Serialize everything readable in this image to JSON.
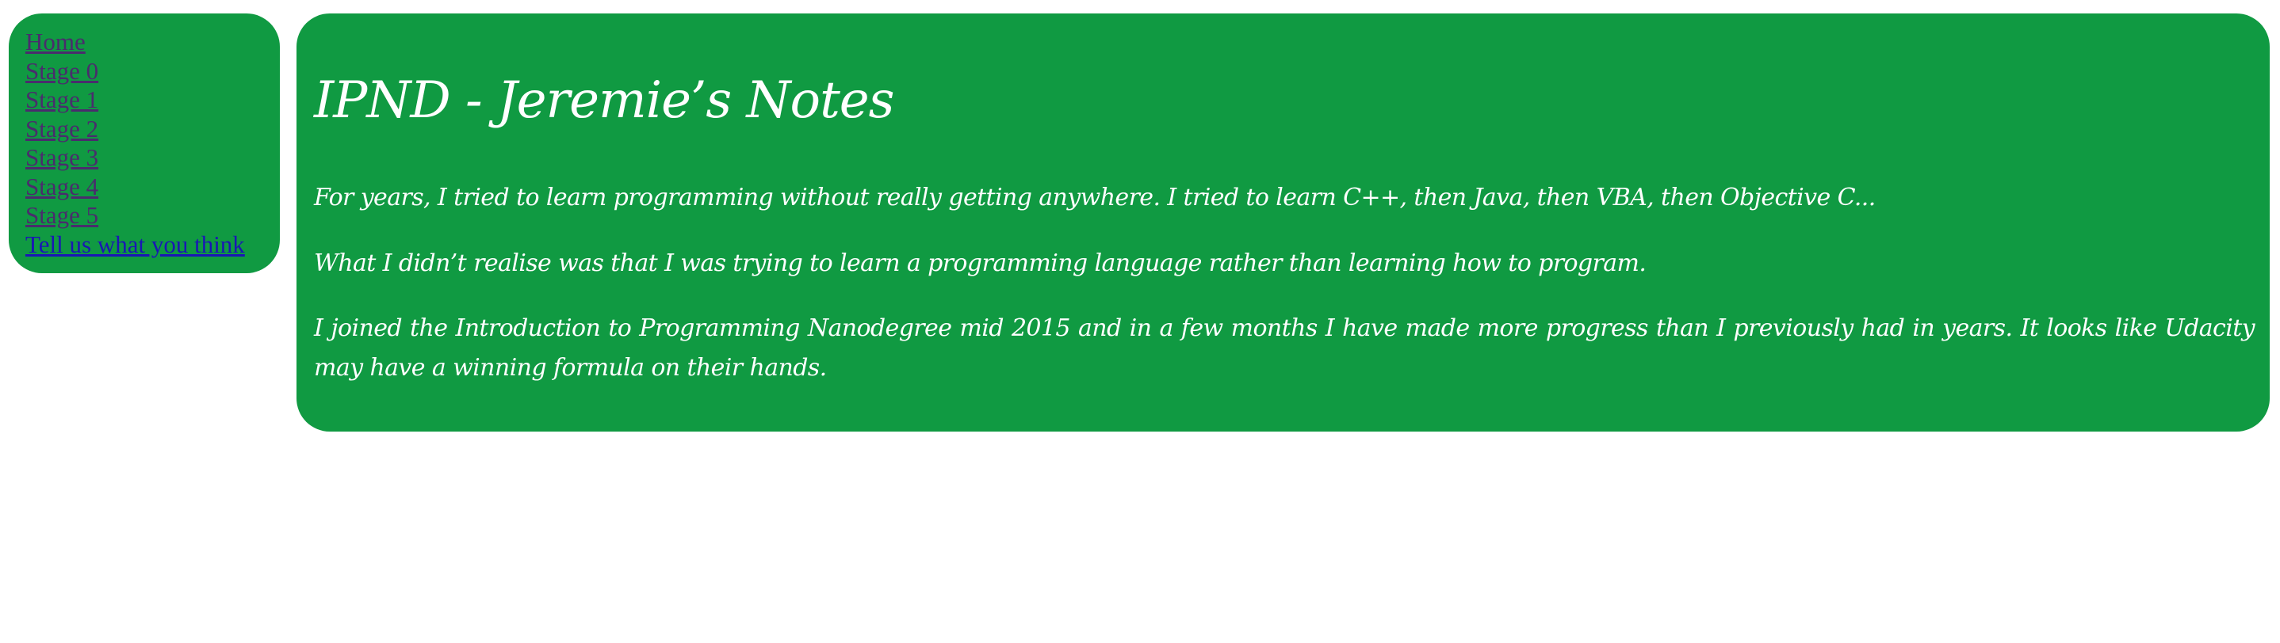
{
  "colors": {
    "panel_background": "#109a42",
    "page_background": "#ffffff",
    "heading_text": "#ffffff",
    "visited_link": "#4a2c6d",
    "unvisited_link": "#1a16b5"
  },
  "nav": {
    "items": [
      {
        "label": "Home",
        "state": "visited"
      },
      {
        "label": "Stage 0",
        "state": "visited"
      },
      {
        "label": "Stage 1",
        "state": "visited"
      },
      {
        "label": "Stage 2",
        "state": "visited"
      },
      {
        "label": "Stage 3",
        "state": "visited"
      },
      {
        "label": "Stage 4",
        "state": "visited"
      },
      {
        "label": "Stage 5",
        "state": "visited"
      },
      {
        "label": "Tell us what you think",
        "state": "unvisited"
      }
    ]
  },
  "main": {
    "title": "IPND - Jeremie’s Notes",
    "paragraphs": [
      "For years, I tried to learn programming without really getting anywhere. I tried to learn C++, then Java, then VBA, then Objective C...",
      "What I didn’t realise was that I was trying to learn a programming language rather than learning how to program.",
      "I joined the Introduction to Programming Nanodegree mid 2015 and in a few months I have made more progress than I previously had in years. It looks like Udacity may have a winning formula on their hands."
    ]
  }
}
